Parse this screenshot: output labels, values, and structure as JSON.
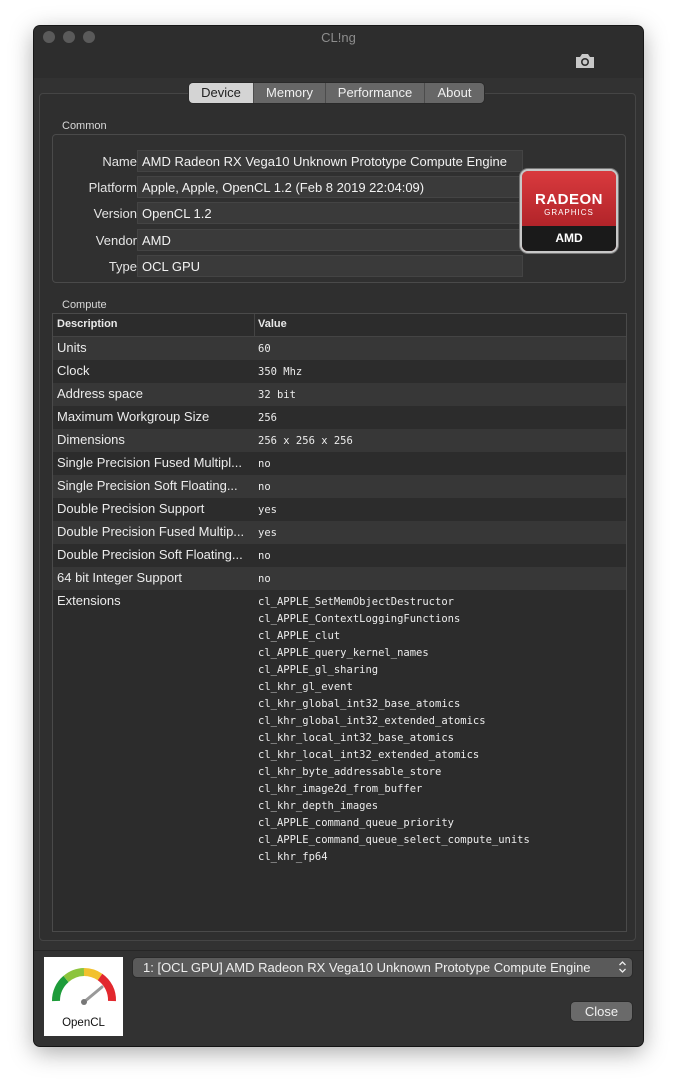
{
  "window": {
    "title": "CL!ng"
  },
  "tabs": [
    {
      "label": "Device",
      "active": true
    },
    {
      "label": "Memory",
      "active": false
    },
    {
      "label": "Performance",
      "active": false
    },
    {
      "label": "About",
      "active": false
    }
  ],
  "common": {
    "label": "Common",
    "fields": [
      {
        "label": "Name",
        "value": "AMD Radeon RX Vega10 Unknown Prototype Compute Engine"
      },
      {
        "label": "Platform",
        "value": "Apple, Apple, OpenCL 1.2 (Feb  8 2019 22:04:09)"
      },
      {
        "label": "Version",
        "value": "OpenCL 1.2"
      },
      {
        "label": "Vendor",
        "value": "AMD"
      },
      {
        "label": "Type",
        "value": "OCL GPU"
      }
    ],
    "vendor_logo": {
      "line1": "RADEON",
      "line2": "GRAPHICS",
      "line3": "AMD",
      "color": "#c8282e"
    }
  },
  "compute": {
    "label": "Compute",
    "columns": [
      "Description",
      "Value"
    ],
    "rows": [
      {
        "desc": "Units",
        "value": "60"
      },
      {
        "desc": "Clock",
        "value": "350 Mhz"
      },
      {
        "desc": "Address space",
        "value": "32 bit"
      },
      {
        "desc": "Maximum Workgroup Size",
        "value": "256"
      },
      {
        "desc": "Dimensions",
        "value": "256 x 256 x 256"
      },
      {
        "desc": "Single Precision Fused Multipl...",
        "value": "no"
      },
      {
        "desc": "Single Precision Soft Floating...",
        "value": "no"
      },
      {
        "desc": "Double Precision Support",
        "value": "yes"
      },
      {
        "desc": "Double Precision Fused Multip...",
        "value": "yes"
      },
      {
        "desc": "Double Precision Soft Floating...",
        "value": "no"
      },
      {
        "desc": "64 bit Integer Support",
        "value": "no"
      }
    ],
    "extensions_label": "Extensions",
    "extensions": [
      "cl_APPLE_SetMemObjectDestructor",
      "cl_APPLE_ContextLoggingFunctions",
      "cl_APPLE_clut",
      "cl_APPLE_query_kernel_names",
      "cl_APPLE_gl_sharing",
      "cl_khr_gl_event",
      "cl_khr_global_int32_base_atomics",
      "cl_khr_global_int32_extended_atomics",
      "cl_khr_local_int32_base_atomics",
      "cl_khr_local_int32_extended_atomics",
      "cl_khr_byte_addressable_store",
      "cl_khr_image2d_from_buffer",
      "cl_khr_depth_images",
      "cl_APPLE_command_queue_priority",
      "cl_APPLE_command_queue_select_compute_units",
      "cl_khr_fp64"
    ]
  },
  "footer": {
    "opencl_logo_text": "OpenCL",
    "device_select": "1: [OCL GPU] AMD Radeon RX Vega10 Unknown Prototype Compute Engine",
    "close_label": "Close"
  },
  "icons": {
    "camera": "camera-icon",
    "select_arrows": "up-down-chevron-icon"
  }
}
